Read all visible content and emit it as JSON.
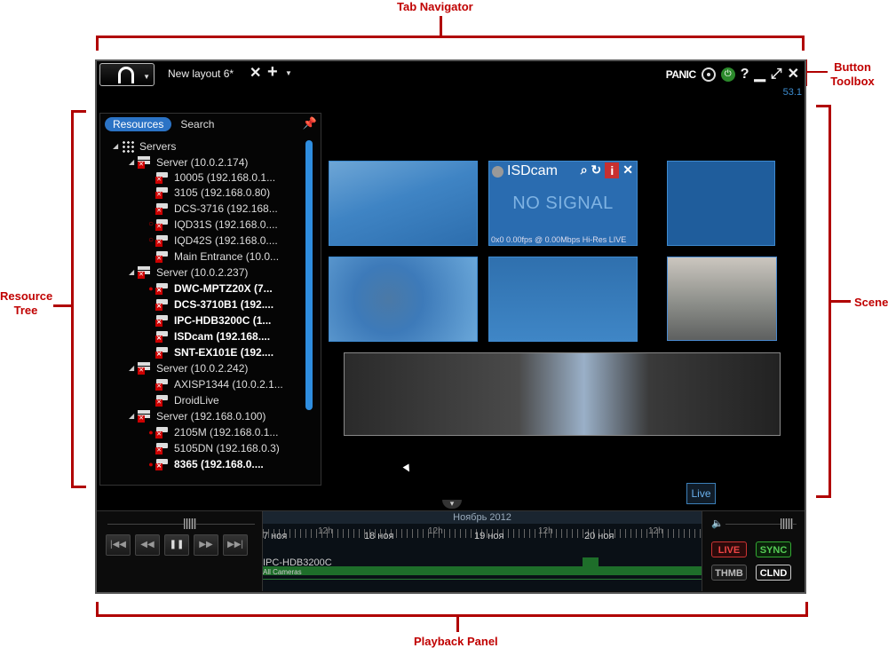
{
  "annotations": {
    "tab_navigator": "Tab Navigator",
    "button_toolbox": "Button Toolbox",
    "resource_tree": "Resource Tree",
    "scene": "Scene",
    "playback_panel": "Playback Panel"
  },
  "title_bar": {
    "tab_label": "New layout 6*",
    "panic_label": "PANIC",
    "fps": "53.1",
    "icons": [
      "logo-icon",
      "close-tab-icon",
      "add-tab-icon",
      "film-reel-icon",
      "power-icon",
      "help-icon",
      "minimize-icon",
      "maximize-icon",
      "close-icon"
    ]
  },
  "resource_tree": {
    "tabs": [
      "Resources",
      "Search"
    ],
    "root": "Servers",
    "nodes": [
      {
        "label": "Server (10.0.2.174)"
      },
      {
        "label": "10005 (192.168.0.1..."
      },
      {
        "label": "3105 (192.168.0.80)"
      },
      {
        "label": "DCS-3716 (192.168..."
      },
      {
        "label": "IQD31S (192.168.0...."
      },
      {
        "label": "IQD42S (192.168.0...."
      },
      {
        "label": "Main Entrance (10.0..."
      },
      {
        "label": "Server (10.0.2.237)"
      },
      {
        "label": "DWC-MPTZ20X (7..."
      },
      {
        "label": "DCS-3710B1 (192...."
      },
      {
        "label": "IPC-HDB3200C (1..."
      },
      {
        "label": "ISDcam (192.168...."
      },
      {
        "label": "SNT-EX101E (192...."
      },
      {
        "label": "Server (10.0.2.242)"
      },
      {
        "label": "AXISP1344 (10.0.2.1..."
      },
      {
        "label": "DroidLive"
      },
      {
        "label": "Server (192.168.0.100)"
      },
      {
        "label": "2105M (192.168.0.1..."
      },
      {
        "label": "5105DN (192.168.0.3)"
      },
      {
        "label": "8365 (192.168.0...."
      }
    ]
  },
  "scene": {
    "isd_tile": {
      "name": "ISDcam",
      "no_signal": "NO SIGNAL",
      "status": "0x0 0.00fps @ 0.00Mbps Hi-Res LIVE"
    },
    "live_tooltip": "Live"
  },
  "playback": {
    "month": "Ноябрь 2012",
    "days": [
      "7 ноя",
      "18 ноя",
      "19 ноя",
      "20 ноя"
    ],
    "hour_label": "12h",
    "camera": "IPC-HDB3200C",
    "all_cameras": "All Cameras",
    "modes": {
      "live": "LIVE",
      "sync": "SYNC",
      "thmb": "THMB",
      "clnd": "CLND"
    }
  }
}
